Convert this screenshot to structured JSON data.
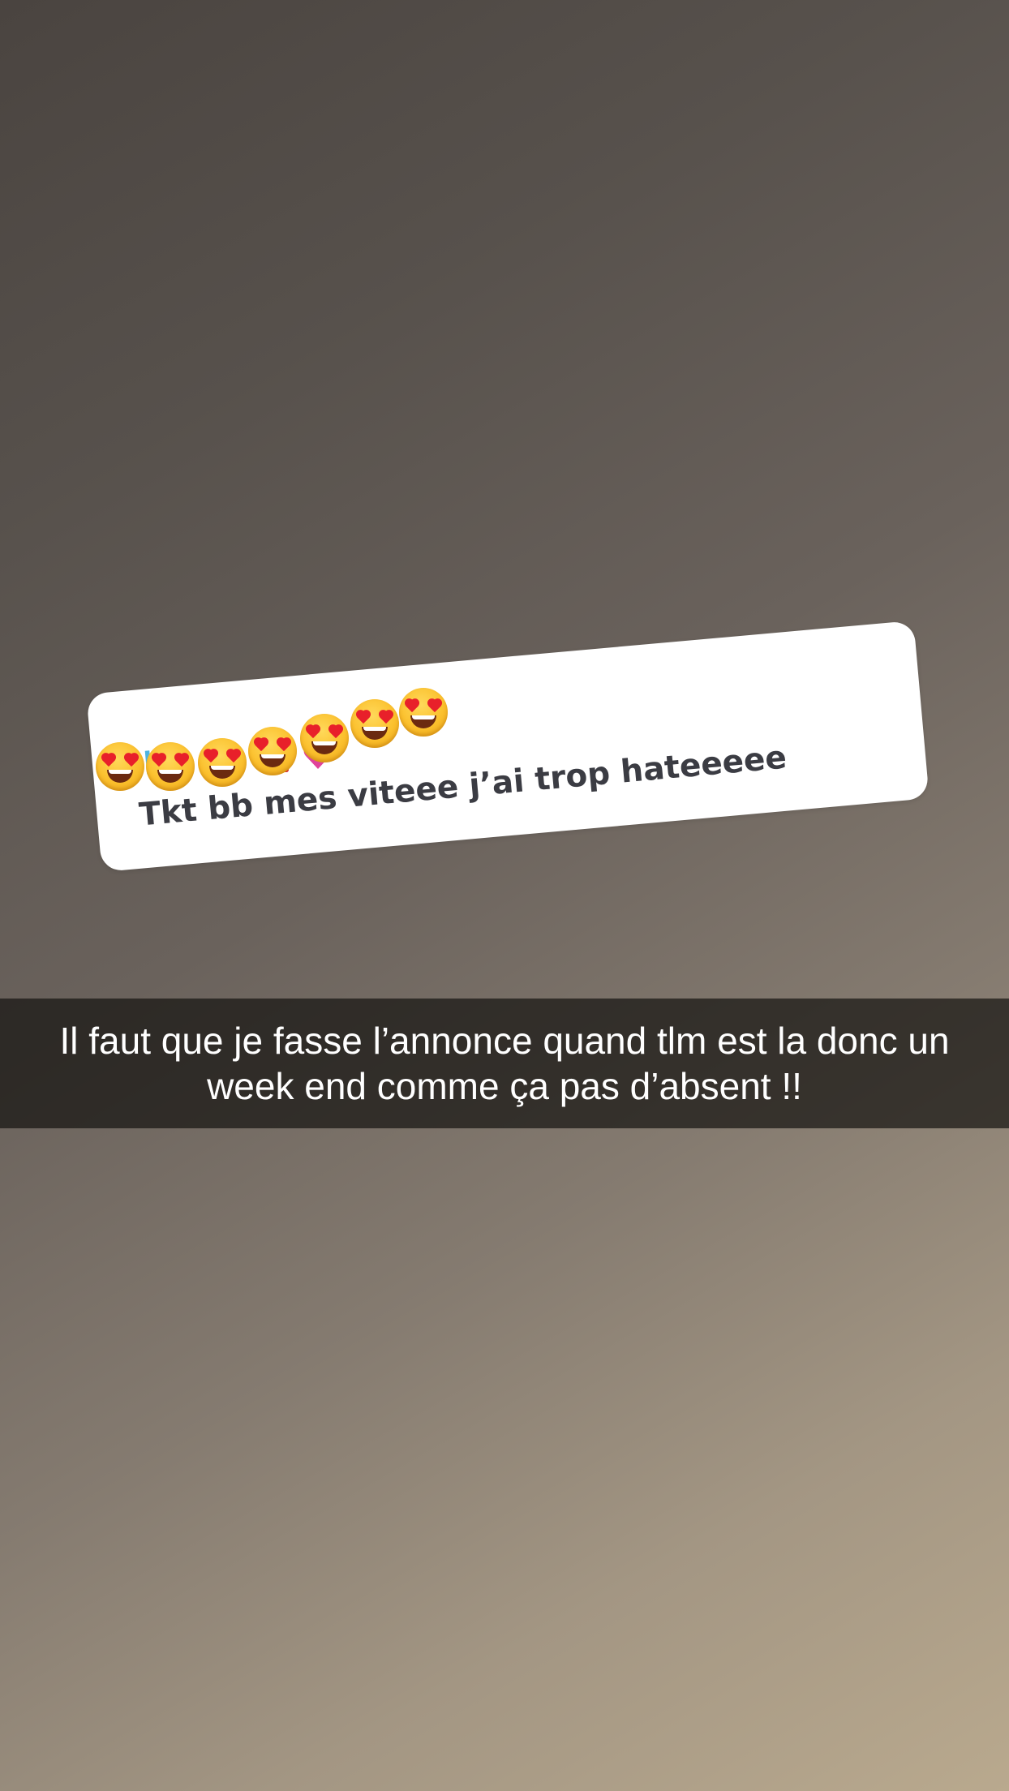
{
  "card": {
    "name": "Nella",
    "message": "Tkt bb mes viteee j’ai trop hateeeee"
  },
  "emojis": [
    "heart-eyes-emoji",
    "heart-eyes-emoji",
    "heart-eyes-emoji",
    "heart-eyes-emoji",
    "heart-eyes-emoji",
    "heart-eyes-emoji",
    "heart-eyes-emoji"
  ],
  "caption": {
    "text": "Il faut que je fasse l’annonce quand tlm est la donc un week end comme ça pas d’absent !!"
  },
  "colors": {
    "card_background": "#ffffff",
    "message_text": "#3b3c43",
    "name_text": "#2ea8dc",
    "caption_text": "#ffffff",
    "emoji_face": "#fbc02d",
    "heart": "#e8202a"
  }
}
